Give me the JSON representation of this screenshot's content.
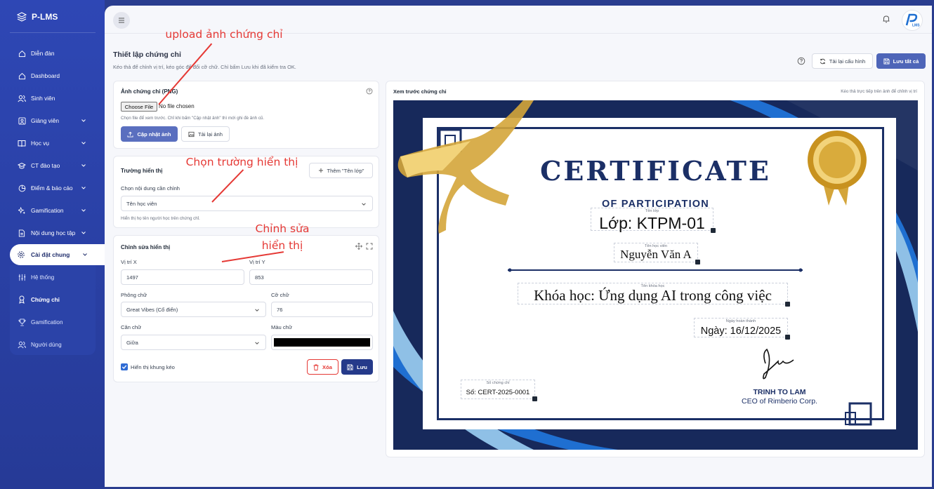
{
  "sidebar": {
    "brand": "P-LMS",
    "items": [
      {
        "label": "Diễn đàn"
      },
      {
        "label": "Dashboard"
      },
      {
        "label": "Sinh viên"
      },
      {
        "label": "Giảng viên"
      },
      {
        "label": "Học vụ"
      },
      {
        "label": "CT đào tạo"
      },
      {
        "label": "Điểm & báo cáo"
      },
      {
        "label": "Gamification"
      },
      {
        "label": "Nội dung học tập"
      },
      {
        "label": "Cài đặt chung"
      }
    ],
    "sub_items": [
      {
        "label": "Hệ thống"
      },
      {
        "label": "Chứng chỉ"
      },
      {
        "label": "Gamification"
      },
      {
        "label": "Người dùng"
      }
    ]
  },
  "header": {
    "title": "Thiết lập chứng chỉ",
    "subtitle": "Kéo thả để chỉnh vị trí, kéo góc để đổi cỡ chữ. Chỉ bấm Lưu khi đã kiểm tra OK.",
    "reload_label": "Tải lại cấu hình",
    "save_all_label": "Lưu tất cả"
  },
  "upload_card": {
    "title": "Ảnh chứng chỉ (PNG)",
    "file_button": "Choose File",
    "file_status": "No file chosen",
    "hint": "Chọn file để xem trước. Chỉ khi bấm \"Cập nhật ảnh\" thì mới ghi đè ảnh cũ.",
    "update_label": "Cập nhật ảnh",
    "reload_label": "Tải lại ảnh"
  },
  "field_card": {
    "title": "Trường hiển thị",
    "add_label": "Thêm \"Tên lớp\"",
    "select_label": "Chọn nội dung cần chỉnh",
    "selected": "Tên học viên",
    "hint": "Hiển thị họ tên người học trên chứng chỉ."
  },
  "edit_card": {
    "title": "Chỉnh sửa hiển thị",
    "x_label": "Vị trí X",
    "x_value": "1497",
    "y_label": "Vị trí Y",
    "y_value": "853",
    "font_label": "Phông chữ",
    "font_value": "Great Vibes (Cổ điển)",
    "size_label": "Cỡ chữ",
    "size_value": "76",
    "align_label": "Căn chữ",
    "align_value": "Giữa",
    "color_label": "Màu chữ",
    "color_value": "#000000",
    "show_frame_label": "Hiển thị khung kéo",
    "show_frame_checked": true,
    "delete_label": "Xóa",
    "save_label": "Lưu"
  },
  "preview": {
    "title": "Xem trước chứng chỉ",
    "hint": "Kéo thả trực tiếp trên ảnh để chỉnh vị trí"
  },
  "certificate": {
    "heading": "CERTIFICATE",
    "subheading": "OF PARTICIPATION",
    "class_label": "Tên lớp",
    "class_value": "Lớp: KTPM-01",
    "student_label": "Tên học viên",
    "student_value": "Nguyễn Văn A",
    "course_label": "Tên khóa học",
    "course_value": "Khóa học: Ứng dụng AI trong công việc",
    "date_label": "Ngày hoàn thành",
    "date_value": "Ngày: 16/12/2025",
    "cert_no_label": "Số chứng chỉ",
    "cert_no_value": "Số: CERT-2025-0001",
    "signer_name": "TRINH TO LAM",
    "signer_title": "CEO of Rimberio Corp."
  },
  "annotations": {
    "upload": "upload ảnh chứng chỉ",
    "choose_field": "Chọn trường hiển thị",
    "edit_line1": "Chỉnh sửa",
    "edit_line2": "hiển thị"
  },
  "colors": {
    "sidebar": "#2e47b5",
    "accent": "#4e65b8",
    "save_button": "#253a8a",
    "delete": "#e53935",
    "cert_navy": "#1b2f66",
    "annotation": "#e53935"
  }
}
